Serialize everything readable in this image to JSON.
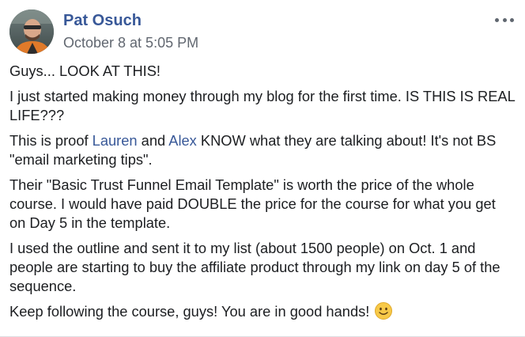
{
  "post": {
    "author": "Pat Osuch",
    "timestamp": "October 8 at 5:05 PM",
    "more_icon": "more-horizontal-icon",
    "paragraphs": {
      "p1": "Guys... LOOK AT THIS!",
      "p2": "I just started making money through my blog for the first time. IS THIS IS REAL LIFE???",
      "p3_before": "This is proof ",
      "p3_link1": "Lauren",
      "p3_mid": " and ",
      "p3_link2": "Alex",
      "p3_after": " KNOW what they are talking about! It's not BS \"email marketing tips\".",
      "p4": "Their \"Basic Trust Funnel Email Template\" is worth the price of the whole course. I would have paid DOUBLE the price for the course for what you get on Day 5 in the template.",
      "p5": "I used the outline and sent it to my list (about 1500 people) on Oct. 1 and people are starting to buy the affiliate product through my link on day 5 of the sequence.",
      "p6": "Keep following the course, guys! You are in good hands!",
      "p6_emoji": "smiley-face-emoji"
    },
    "colors": {
      "link": "#385898",
      "meta": "#616770",
      "text": "#1c1e21"
    }
  }
}
